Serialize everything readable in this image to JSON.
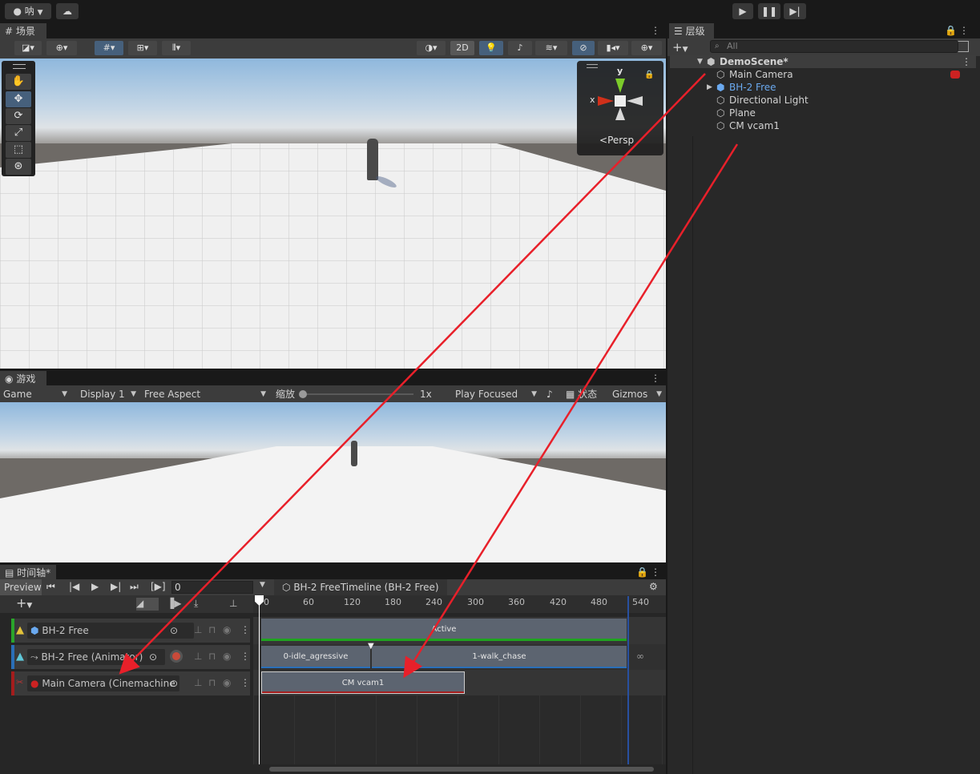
{
  "toolbar": {
    "account_label": "呐",
    "account_icon": "account-icon",
    "cloud_icon": "cloud-icon",
    "play_icon": "play-icon",
    "pause_icon": "pause-icon",
    "step_icon": "step-icon"
  },
  "scene": {
    "tab_label": "场景",
    "mode_2d_label": "2D",
    "persp_label": "Persp",
    "axis_x": "x",
    "axis_y": "y"
  },
  "game": {
    "tab_label": "游戏",
    "view_dropdown": "Game",
    "display_dropdown": "Display 1",
    "aspect_dropdown": "Free Aspect",
    "scale_label": "缩放",
    "scale_value": "1x",
    "play_mode_dropdown": "Play Focused",
    "stats_label": "状态",
    "gizmos_dropdown": "Gizmos"
  },
  "hierarchy": {
    "tab_label": "层级",
    "search_placeholder": "All",
    "scene_name": "DemoScene*",
    "items": [
      {
        "label": "Main Camera",
        "color": "#d2d2d2"
      },
      {
        "label": "BH-2 Free",
        "color": "#6aa9ef"
      },
      {
        "label": "Directional Light",
        "color": "#d2d2d2"
      },
      {
        "label": "Plane",
        "color": "#d2d2d2"
      },
      {
        "label": "CM vcam1",
        "color": "#d2d2d2"
      }
    ]
  },
  "timeline": {
    "tab_label": "时间轴*",
    "preview_label": "Preview",
    "frame_value": "0",
    "asset_label": "BH-2 FreeTimeline (BH-2 Free)",
    "ruler_ticks": [
      "0",
      "60",
      "120",
      "180",
      "240",
      "300",
      "360",
      "420",
      "480",
      "540"
    ],
    "tracks": [
      {
        "label": "BH-2 Free",
        "stripe": "#2aa52a"
      },
      {
        "label": "BH-2 Free (Animator)",
        "stripe": "#2a6fb8"
      },
      {
        "label": "Main Camera (Cinemachine",
        "stripe": "#a41d1d"
      }
    ],
    "clips": {
      "active": "Active",
      "idle": "0-idle_agressive",
      "walk": "1-walk_chase",
      "vcam": "CM vcam1"
    }
  },
  "colors": {
    "accent_blue": "#46607c",
    "annotation_red": "#e8202a",
    "active_green": "#1fa31f"
  }
}
